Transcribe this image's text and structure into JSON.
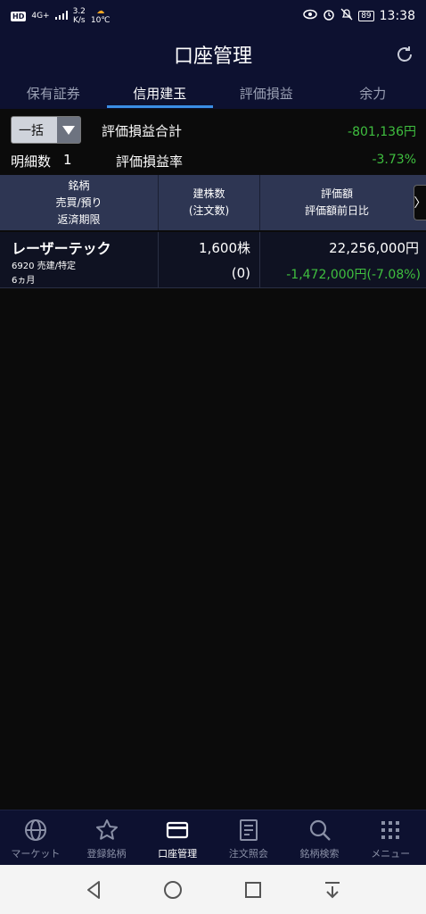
{
  "status_bar": {
    "hd": "HD",
    "network": "4G+",
    "speed_value": "3.2",
    "speed_unit": "K/s",
    "weather_temp": "10℃",
    "battery": "89",
    "time": "13:38"
  },
  "header": {
    "title": "口座管理"
  },
  "tabs": [
    {
      "label": "保有証券",
      "active": false
    },
    {
      "label": "信用建玉",
      "active": true
    },
    {
      "label": "評価損益",
      "active": false
    },
    {
      "label": "余力",
      "active": false
    }
  ],
  "summary": {
    "select_value": "一括",
    "total_pl_label": "評価損益合計",
    "total_pl_value": "-801,136円",
    "count_label": "明細数",
    "count_value": "1",
    "rate_label": "評価損益率",
    "rate_value": "-3.73%"
  },
  "table": {
    "header": {
      "col1_line1": "銘柄",
      "col1_line2": "売買/預り",
      "col1_line3": "返済期限",
      "col2_line1": "建株数",
      "col2_line2": "(注文数)",
      "col3_line1": "評価額",
      "col3_line2": "評価額前日比",
      "next_arrow": "〉"
    },
    "rows": [
      {
        "name": "レーザーテック",
        "code_type": "6920 売建/特定",
        "term": "6ヵ月",
        "quantity": "1,600株",
        "order_quantity": "(0)",
        "valuation": "22,256,000円",
        "valuation_change": "-1,472,000円(-7.08%)"
      }
    ]
  },
  "bottom_nav": [
    {
      "label": "マーケット",
      "icon": "globe-icon",
      "active": false
    },
    {
      "label": "登録銘柄",
      "icon": "star-icon",
      "active": false
    },
    {
      "label": "口座管理",
      "icon": "card-icon",
      "active": true
    },
    {
      "label": "注文照会",
      "icon": "document-icon",
      "active": false
    },
    {
      "label": "銘柄検索",
      "icon": "search-icon",
      "active": false
    },
    {
      "label": "メニュー",
      "icon": "grid-menu-icon",
      "active": false
    }
  ],
  "colors": {
    "header_bg": "#0d1130",
    "accent": "#3a8ee6",
    "negative_green": "#3fbf3f",
    "table_header_bg": "#2e3653"
  }
}
